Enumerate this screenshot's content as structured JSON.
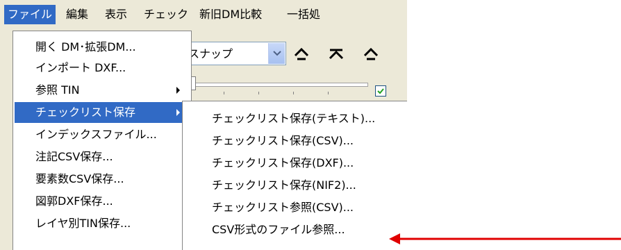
{
  "menubar": {
    "items": [
      {
        "label": "ファイル"
      },
      {
        "label": "編集"
      },
      {
        "label": "表示"
      },
      {
        "label": "チェック"
      },
      {
        "label": "新旧DM比較"
      },
      {
        "label": "一括処"
      }
    ]
  },
  "toolbar": {
    "combo_value": "スナップ"
  },
  "file_menu": {
    "items": [
      {
        "label": "開く DM･拡張DM..."
      },
      {
        "label": "インポート DXF..."
      },
      {
        "label": "参照 TIN"
      },
      {
        "label": "チェックリスト保存"
      },
      {
        "label": "インデックスファイル..."
      },
      {
        "label": "注記CSV保存..."
      },
      {
        "label": "要素数CSV保存..."
      },
      {
        "label": "図郭DXF保存..."
      },
      {
        "label": "レイヤ別TIN保存..."
      }
    ]
  },
  "submenu": {
    "items": [
      {
        "label": "チェックリスト保存(テキスト)..."
      },
      {
        "label": "チェックリスト保存(CSV)..."
      },
      {
        "label": "チェックリスト保存(DXF)..."
      },
      {
        "label": "チェックリスト保存(NIF2)..."
      },
      {
        "label": "チェックリスト参照(CSV)..."
      },
      {
        "label": "CSV形式のファイル参照..."
      }
    ]
  },
  "colors": {
    "menu_highlight": "#316ac5",
    "annotation_arrow": "#e00000",
    "window_face": "#ece9d8"
  }
}
